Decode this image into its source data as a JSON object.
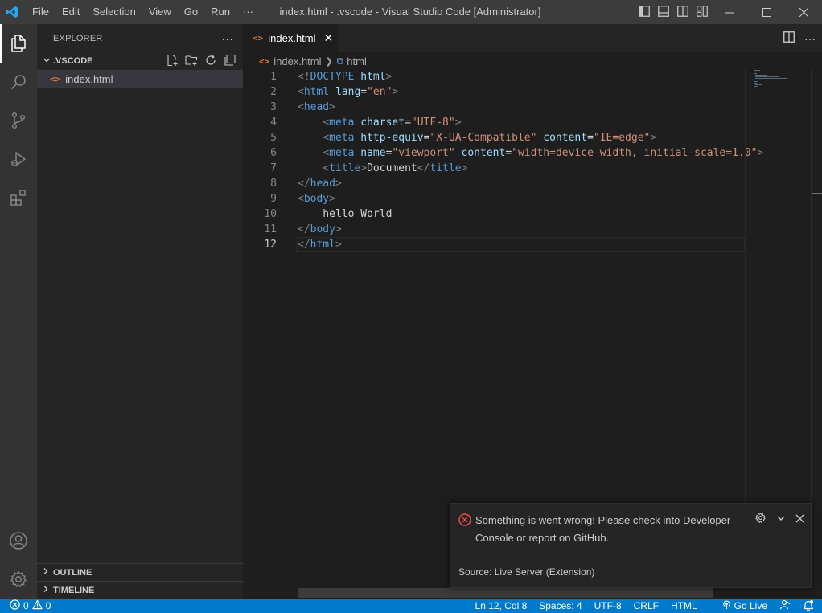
{
  "titlebar": {
    "menu": [
      "File",
      "Edit",
      "Selection",
      "View",
      "Go",
      "Run",
      "···"
    ],
    "title": "index.html - .vscode - Visual Studio Code [Administrator]"
  },
  "sidebar": {
    "header": "EXPLORER",
    "more": "···",
    "folder": ".VSCODE",
    "files": [
      {
        "icon": "<>",
        "name": "index.html"
      }
    ],
    "outline": "OUTLINE",
    "timeline": "TIMELINE"
  },
  "tab": {
    "icon": "<>",
    "label": "index.html",
    "close": "✕"
  },
  "breadcrumb": {
    "file": "index.html",
    "symbol": "html"
  },
  "code": {
    "line_numbers": [
      "1",
      "2",
      "3",
      "4",
      "5",
      "6",
      "7",
      "8",
      "9",
      "10",
      "11",
      "12"
    ],
    "current_line": 12,
    "lines": [
      "<!DOCTYPE html>",
      "<html lang=\"en\">",
      "<head>",
      "    <meta charset=\"UTF-8\">",
      "    <meta http-equiv=\"X-UA-Compatible\" content=\"IE=edge\">",
      "    <meta name=\"viewport\" content=\"width=device-width, initial-scale=1.0\">",
      "    <title>Document</title>",
      "</head>",
      "<body>",
      "    hello World",
      "</body>",
      "</html>"
    ]
  },
  "notification": {
    "message": "Something is went wrong! Please check into Developer Console or report on GitHub.",
    "source": "Source: Live Server (Extension)"
  },
  "statusbar": {
    "errors": "0",
    "warnings": "0",
    "position": "Ln 12, Col 8",
    "spaces": "Spaces: 4",
    "encoding": "UTF-8",
    "eol": "CRLF",
    "language": "HTML",
    "golive": "Go Live"
  },
  "colors": {
    "accent": "#007acc",
    "tag": "#569cd6",
    "attr": "#9cdcfe",
    "string": "#ce9178",
    "html_file_icon": "#e37933",
    "error": "#f14c4c"
  }
}
